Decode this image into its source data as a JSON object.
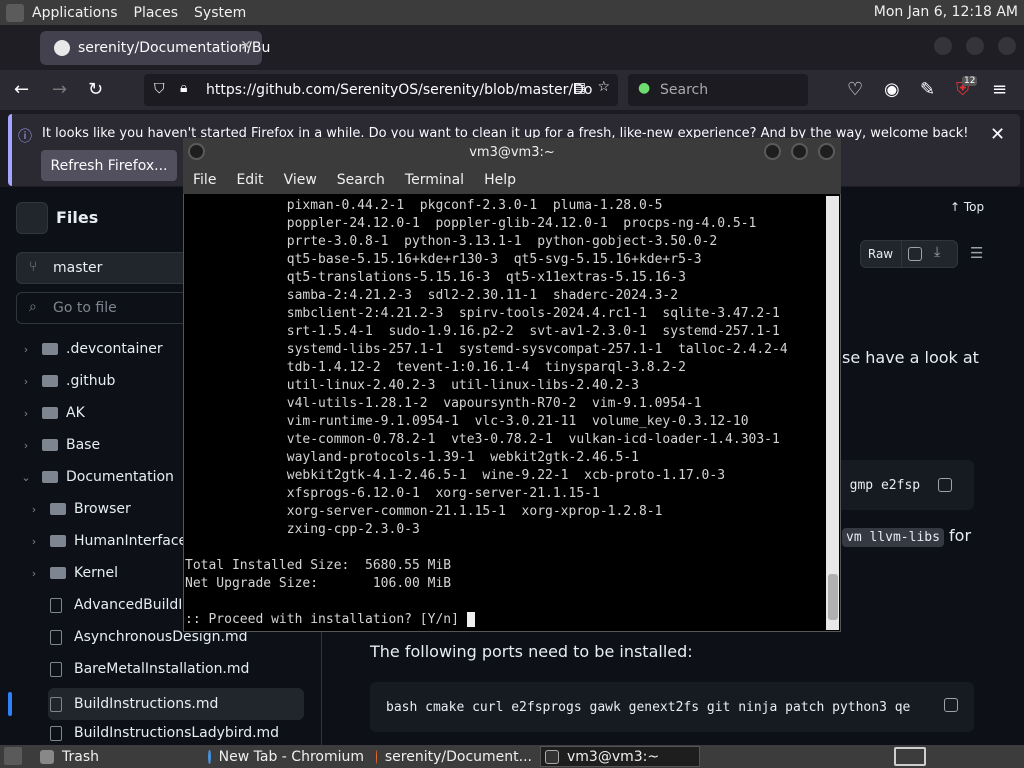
{
  "desktop": {
    "menu": [
      "Applications",
      "Places",
      "System"
    ],
    "clock": "Mon Jan  6, 12:18 AM"
  },
  "firefox": {
    "tab_title": "serenity/Documentation/Bu",
    "url_host": "https://github.com/SerenityOS/serenity/blob/master/Do",
    "search_placeholder": "Search",
    "infobar_text": "It looks like you haven't started Firefox in a while. Do you want to clean it up for a fresh, like-new experience? And by the way, welcome back!",
    "refresh_label": "Refresh Firefox...",
    "extension_badge": "12"
  },
  "github": {
    "files_title": "Files",
    "branch": "master",
    "goto_placeholder": "Go to file",
    "top_label": "Top",
    "raw_label": "Raw",
    "tree": [
      {
        "label": ".devcontainer",
        "kind": "folder"
      },
      {
        "label": ".github",
        "kind": "folder"
      },
      {
        "label": "AK",
        "kind": "folder"
      },
      {
        "label": "Base",
        "kind": "folder"
      },
      {
        "label": "Documentation",
        "kind": "folder-open"
      },
      {
        "label": "Browser",
        "kind": "folder"
      },
      {
        "label": "HumanInterfaceG",
        "kind": "folder"
      },
      {
        "label": "Kernel",
        "kind": "folder"
      },
      {
        "label": "AdvancedBuildIns",
        "kind": "file"
      },
      {
        "label": "AsynchronousDesign.md",
        "kind": "file"
      },
      {
        "label": "BareMetalInstallation.md",
        "kind": "file"
      },
      {
        "label": "BuildInstructions.md",
        "kind": "file"
      },
      {
        "label": "BuildInstructionsLadybird.md",
        "kind": "file"
      }
    ],
    "md_fragment_1": "se have a look at",
    "code_fragment_1": "c gmp e2fsp",
    "code_fragment_2": "vm llvm-libs",
    "md_fragment_2": "for",
    "ports_text": "The following ports need to be installed:",
    "ports_code": "bash cmake curl e2fsprogs gawk genext2fs git ninja patch python3 qe"
  },
  "terminal": {
    "title": "vm3@vm3:~",
    "menu": [
      "File",
      "Edit",
      "View",
      "Search",
      "Terminal",
      "Help"
    ],
    "lines": [
      "             pixman-0.44.2-1  pkgconf-2.3.0-1  pluma-1.28.0-5",
      "             poppler-24.12.0-1  poppler-glib-24.12.0-1  procps-ng-4.0.5-1",
      "             prrte-3.0.8-1  python-3.13.1-1  python-gobject-3.50.0-2",
      "             qt5-base-5.15.16+kde+r130-3  qt5-svg-5.15.16+kde+r5-3",
      "             qt5-translations-5.15.16-3  qt5-x11extras-5.15.16-3",
      "             samba-2:4.21.2-3  sdl2-2.30.11-1  shaderc-2024.3-2",
      "             smbclient-2:4.21.2-3  spirv-tools-2024.4.rc1-1  sqlite-3.47.2-1",
      "             srt-1.5.4-1  sudo-1.9.16.p2-2  svt-av1-2.3.0-1  systemd-257.1-1",
      "             systemd-libs-257.1-1  systemd-sysvcompat-257.1-1  talloc-2.4.2-4",
      "             tdb-1.4.12-2  tevent-1:0.16.1-4  tinysparql-3.8.2-2",
      "             util-linux-2.40.2-3  util-linux-libs-2.40.2-3",
      "             v4l-utils-1.28.1-2  vapoursynth-R70-2  vim-9.1.0954-1",
      "             vim-runtime-9.1.0954-1  vlc-3.0.21-11  volume_key-0.3.12-10",
      "             vte-common-0.78.2-1  vte3-0.78.2-1  vulkan-icd-loader-1.4.303-1",
      "             wayland-protocols-1.39-1  webkit2gtk-2.46.5-1",
      "             webkit2gtk-4.1-2.46.5-1  wine-9.22-1  xcb-proto-1.17.0-3",
      "             xfsprogs-6.12.0-1  xorg-server-21.1.15-1",
      "             xorg-server-common-21.1.15-1  xorg-xprop-1.2.8-1",
      "             zxing-cpp-2.3.0-3",
      "",
      "Total Installed Size:  5680.55 MiB",
      "Net Upgrade Size:       106.00 MiB",
      ""
    ],
    "prompt": ":: Proceed with installation? [Y/n] "
  },
  "taskbar": {
    "items": [
      "Trash",
      "New Tab - Chromium",
      "serenity/Document...",
      "vm3@vm3:~"
    ]
  }
}
